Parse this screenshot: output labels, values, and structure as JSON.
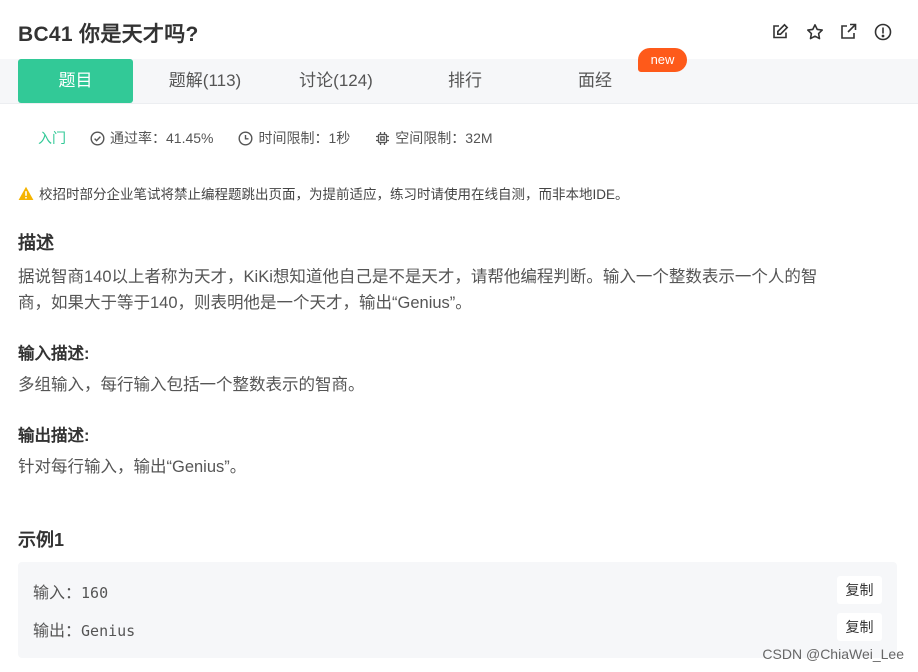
{
  "header": {
    "title": "BC41  你是天才吗?",
    "icons": [
      "edit-icon",
      "star-icon",
      "external-link-icon",
      "info-icon"
    ]
  },
  "tabs": [
    {
      "label": "题目",
      "active": true
    },
    {
      "label": "题解(113)",
      "active": false
    },
    {
      "label": "讨论(124)",
      "active": false
    },
    {
      "label": "排行",
      "active": false
    },
    {
      "label": "面经",
      "active": false
    }
  ],
  "new_badge": "new",
  "meta": {
    "difficulty": "入门",
    "pass_rate": "通过率：41.45%",
    "time_limit": "时间限制：1秒",
    "space_limit": "空间限制：32M"
  },
  "warning": "校招时部分企业笔试将禁止编程题跳出页面，为提前适应，练习时请使用在线自测，而非本地IDE。",
  "description": {
    "heading": "描述",
    "line1": "据说智商140以上者称为天才，KiKi想知道他自己是不是天才，请帮他编程判断。输入一个整数表示一个人的智",
    "line2": "商，如果大于等于140，则表明他是一个天才，输出“Genius”。"
  },
  "input_desc": {
    "heading": "输入描述:",
    "text": "多组输入，每行输入包括一个整数表示的智商。"
  },
  "output_desc": {
    "heading": "输出描述:",
    "text": "针对每行输入，输出“Genius”。"
  },
  "example": {
    "heading": "示例1",
    "input_label": "输入：",
    "input_value": "160",
    "output_label": "输出：",
    "output_value": "Genius",
    "copy_label": "复制"
  },
  "watermark": "CSDN @ChiaWei_Lee",
  "colors": {
    "accent": "#32c997",
    "badge": "#fe5a1a",
    "warning": "#f5b400"
  }
}
